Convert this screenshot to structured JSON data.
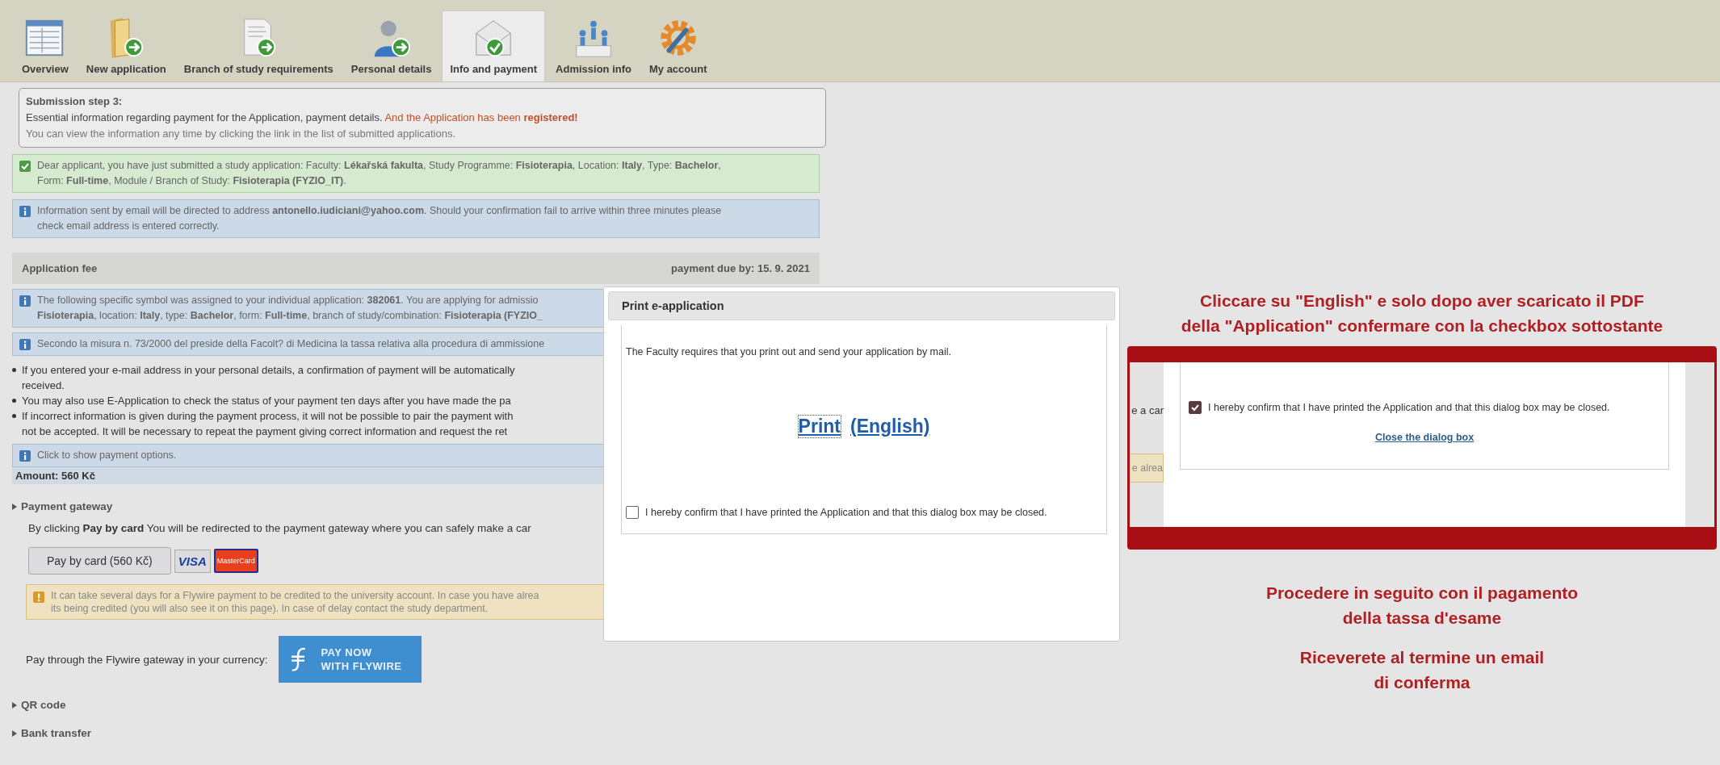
{
  "tabs": [
    {
      "label": "Overview",
      "selected": false
    },
    {
      "label": "New application",
      "selected": false
    },
    {
      "label": "Branch of study requirements",
      "selected": false
    },
    {
      "label": "Personal details",
      "selected": false
    },
    {
      "label": "Info and payment",
      "selected": true
    },
    {
      "label": "Admission info",
      "selected": false
    },
    {
      "label": "My account",
      "selected": false
    }
  ],
  "submission_step": {
    "title": "Submission step 3:",
    "text": "Essential information regarding payment for the Application, payment details.",
    "notice": "And the Application has been **registered!**",
    "hint": "You can view the information any time by clicking the link in the list of submitted applications."
  },
  "messages": [
    {
      "kind": "success",
      "lines": [
        "Dear applicant, you have just submitted a study application: Faculty: **Lékařská fakulta**, Study Programme: **Fisioterapia**, Location: **Italy**, Type: **Bachelor**,",
        "Form: **Full-time**, Module / Branch of Study: **Fisioterapia (FYZIO_IT)**."
      ]
    },
    {
      "kind": "info",
      "lines": [
        "Information sent by email will be directed to address **antonello.iudiciani@yahoo.com**. Should your confirmation fail to arrive within three minutes please",
        "check email address is entered correctly."
      ]
    }
  ],
  "application_fee": {
    "title": "Application fee",
    "due": "payment due by: 15. 9. 2021",
    "notes": [
      {
        "kind": "info",
        "lines": [
          "The following specific symbol was assigned to your individual application: **382061**. You are applying for admissio",
          "**Fisioterapia**, location: **Italy**, type: **Bachelor**, form: **Full-time**, branch of study/combination: **Fisioterapia (FYZIO_**"
        ]
      },
      {
        "kind": "info",
        "lines": [
          "Secondo la misura n. 73/2000 del preside della Facolt? di Medicina la tassa relativa alla procedura di ammissione"
        ]
      }
    ],
    "bullets": [
      {
        "lines": [
          "If you entered your e-mail address in your personal details, a confirmation of payment will be automatically",
          "received."
        ]
      },
      {
        "lines": [
          "You may also use E-Application to check the status of your payment ten days after you have made the pa"
        ]
      },
      {
        "lines": [
          "If incorrect information is given during the payment process, it will not be possible to pair the payment with",
          "not be accepted. It will be necessary to repeat the payment giving correct information and request the ret"
        ]
      }
    ],
    "options_hint": "Click to show payment options.",
    "amount": "Amount: 560 Kč",
    "sections": [
      {
        "title": "Payment gateway",
        "gateway": {
          "intro": "By clicking **Pay by card** You will be redirected to the payment gateway where you can safely make a car",
          "pay_button": "Pay by card (560 Kč)",
          "card_logos": [
            "VISA",
            "MasterCard"
          ],
          "warning_lines": [
            "It can take several days for a Flywire payment to be credited to the university account. In case you have alrea",
            "its being credited (you will also see it on this page). In case of delay contact the study department."
          ],
          "flywire_label": "Pay through the Flywire gateway in your currency:",
          "flywire_button": [
            "PAY NOW",
            "WITH FLYWIRE"
          ]
        }
      },
      {
        "title": "QR code"
      },
      {
        "title": "Bank transfer"
      }
    ]
  },
  "dialog": {
    "title": "Print e-application",
    "text": "The Faculty requires that you print out and send your application by mail.",
    "print_link": "Print",
    "english_link": "(English)",
    "confirm": {
      "label": "I hereby confirm that I have printed the Application and that this dialog box may be closed.",
      "checked": false
    }
  },
  "annotation_top": [
    "Cliccare su \"English\" e solo dopo aver scaricato il PDF",
    "della \"Application\" confermare con la checkbox sottostante"
  ],
  "inset": {
    "fragments": [
      "e a car",
      "e alrea"
    ],
    "confirm": {
      "label": "I hereby confirm that I have printed the Application and that this dialog box may be closed.",
      "checked": true
    },
    "close_link": "Close the dialog box"
  },
  "annotation_bottom": [
    [
      "Procedere in seguito con il pagamento",
      "della tassa d'esame"
    ],
    [
      "Riceverete al termine un email",
      "di conferma"
    ]
  ]
}
